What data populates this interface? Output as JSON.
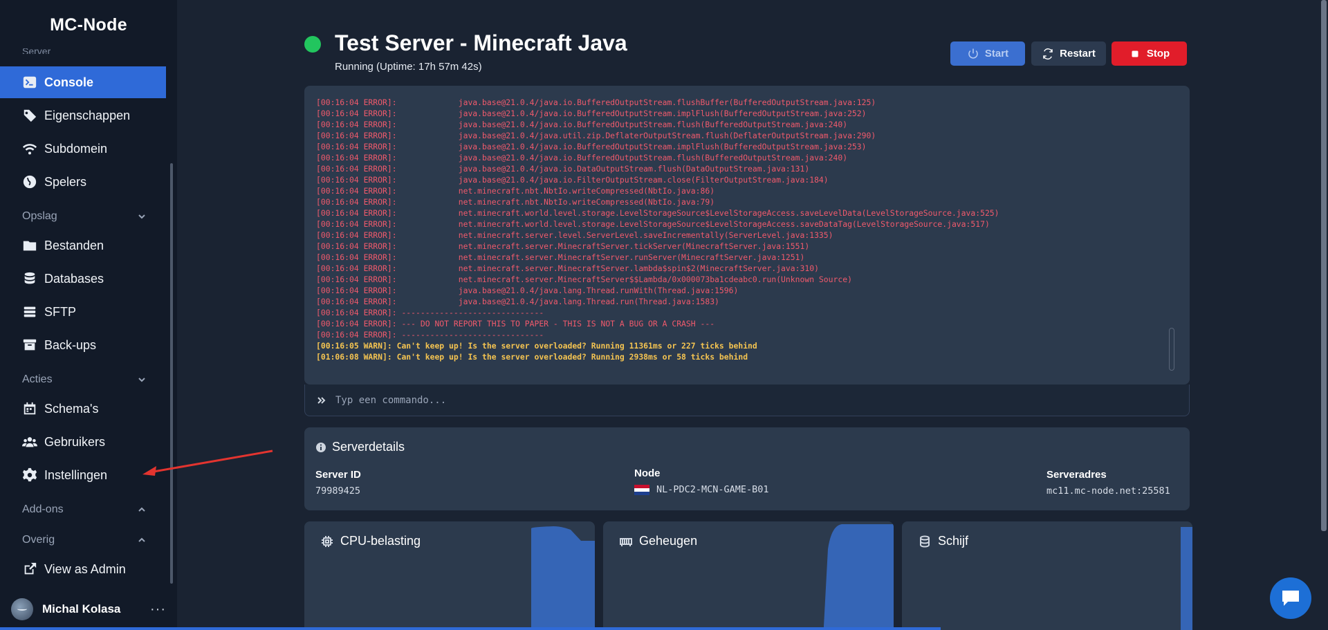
{
  "sidebar": {
    "brand": "MC-Node",
    "cut_section": "Server",
    "items": [
      {
        "label": "Console",
        "icon": "terminal-icon",
        "active": true
      },
      {
        "label": "Eigenschappen",
        "icon": "tag-icon"
      },
      {
        "label": "Subdomein",
        "icon": "wifi-icon"
      },
      {
        "label": "Spelers",
        "icon": "globe-icon"
      },
      {
        "label": "Bestanden",
        "icon": "folder-icon"
      },
      {
        "label": "Databases",
        "icon": "database-icon"
      },
      {
        "label": "SFTP",
        "icon": "stack-icon"
      },
      {
        "label": "Back-ups",
        "icon": "archive-icon"
      },
      {
        "label": "Schema's",
        "icon": "calendar-icon"
      },
      {
        "label": "Gebruikers",
        "icon": "users-icon"
      },
      {
        "label": "Instellingen",
        "icon": "gear-icon"
      },
      {
        "label": "View as Admin",
        "icon": "external-link-icon"
      }
    ],
    "sections": {
      "opslag": "Opslag",
      "acties": "Acties",
      "addons": "Add-ons",
      "overig": "Overig"
    },
    "user": {
      "name": "Michal Kolasa",
      "more": "···"
    }
  },
  "header": {
    "title": "Test Server - Minecraft Java",
    "status": "Running (Uptime: 17h 57m 42s)",
    "status_color": "#22c55e",
    "buttons": {
      "start": "Start",
      "restart": "Restart",
      "stop": "Stop"
    }
  },
  "console": {
    "lines": [
      {
        "level": "err",
        "text": "[00:16:04 ERROR]:             java.base@21.0.4/java.io.BufferedOutputStream.flushBuffer(BufferedOutputStream.java:125)"
      },
      {
        "level": "err",
        "text": "[00:16:04 ERROR]:             java.base@21.0.4/java.io.BufferedOutputStream.implFlush(BufferedOutputStream.java:252)"
      },
      {
        "level": "err",
        "text": "[00:16:04 ERROR]:             java.base@21.0.4/java.io.BufferedOutputStream.flush(BufferedOutputStream.java:240)"
      },
      {
        "level": "err",
        "text": "[00:16:04 ERROR]:             java.base@21.0.4/java.util.zip.DeflaterOutputStream.flush(DeflaterOutputStream.java:290)"
      },
      {
        "level": "err",
        "text": "[00:16:04 ERROR]:             java.base@21.0.4/java.io.BufferedOutputStream.implFlush(BufferedOutputStream.java:253)"
      },
      {
        "level": "err",
        "text": "[00:16:04 ERROR]:             java.base@21.0.4/java.io.BufferedOutputStream.flush(BufferedOutputStream.java:240)"
      },
      {
        "level": "err",
        "text": "[00:16:04 ERROR]:             java.base@21.0.4/java.io.DataOutputStream.flush(DataOutputStream.java:131)"
      },
      {
        "level": "err",
        "text": "[00:16:04 ERROR]:             java.base@21.0.4/java.io.FilterOutputStream.close(FilterOutputStream.java:184)"
      },
      {
        "level": "err",
        "text": "[00:16:04 ERROR]:             net.minecraft.nbt.NbtIo.writeCompressed(NbtIo.java:86)"
      },
      {
        "level": "err",
        "text": "[00:16:04 ERROR]:             net.minecraft.nbt.NbtIo.writeCompressed(NbtIo.java:79)"
      },
      {
        "level": "err",
        "text": "[00:16:04 ERROR]:             net.minecraft.world.level.storage.LevelStorageSource$LevelStorageAccess.saveLevelData(LevelStorageSource.java:525)"
      },
      {
        "level": "err",
        "text": "[00:16:04 ERROR]:             net.minecraft.world.level.storage.LevelStorageSource$LevelStorageAccess.saveDataTag(LevelStorageSource.java:517)"
      },
      {
        "level": "err",
        "text": "[00:16:04 ERROR]:             net.minecraft.server.level.ServerLevel.saveIncrementally(ServerLevel.java:1335)"
      },
      {
        "level": "err",
        "text": "[00:16:04 ERROR]:             net.minecraft.server.MinecraftServer.tickServer(MinecraftServer.java:1551)"
      },
      {
        "level": "err",
        "text": "[00:16:04 ERROR]:             net.minecraft.server.MinecraftServer.runServer(MinecraftServer.java:1251)"
      },
      {
        "level": "err",
        "text": "[00:16:04 ERROR]:             net.minecraft.server.MinecraftServer.lambda$spin$2(MinecraftServer.java:310)"
      },
      {
        "level": "err",
        "text": "[00:16:04 ERROR]:             net.minecraft.server.MinecraftServer$$Lambda/0x000073ba1cdeabc0.run(Unknown Source)"
      },
      {
        "level": "err",
        "text": "[00:16:04 ERROR]:             java.base@21.0.4/java.lang.Thread.runWith(Thread.java:1596)"
      },
      {
        "level": "err",
        "text": "[00:16:04 ERROR]:             java.base@21.0.4/java.lang.Thread.run(Thread.java:1583)"
      },
      {
        "level": "err",
        "text": "[00:16:04 ERROR]: ------------------------------"
      },
      {
        "level": "err",
        "text": "[00:16:04 ERROR]: --- DO NOT REPORT THIS TO PAPER - THIS IS NOT A BUG OR A CRASH ---"
      },
      {
        "level": "err",
        "text": "[00:16:04 ERROR]: ------------------------------"
      },
      {
        "level": "warn",
        "text": "[00:16:05 WARN]: Can't keep up! Is the server overloaded? Running 11361ms or 227 ticks behind"
      },
      {
        "level": "warn",
        "text": "[01:06:08 WARN]: Can't keep up! Is the server overloaded? Running 2938ms or 58 ticks behind"
      }
    ],
    "command_placeholder": "Typ een commando..."
  },
  "details": {
    "title": "Serverdetails",
    "server_id_label": "Server ID",
    "server_id": "79989425",
    "node_label": "Node",
    "node": "NL-PDC2-MCN-GAME-B01",
    "address_label": "Serveradres",
    "address": "mc11.mc-node.net:25581"
  },
  "stats": {
    "cpu": "CPU-belasting",
    "memory": "Geheugen",
    "disk": "Schijf",
    "accent": "#3565b6"
  }
}
